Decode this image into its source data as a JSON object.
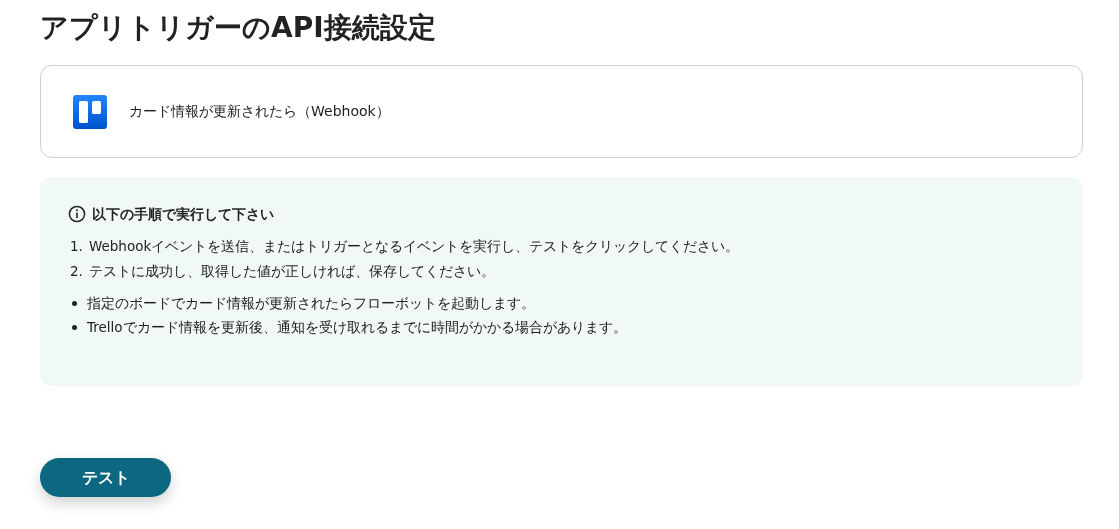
{
  "title": "アプリトリガーのAPI接続設定",
  "trigger": {
    "label": "カード情報が更新されたら（Webhook）"
  },
  "info": {
    "heading": "以下の手順で実行して下さい",
    "steps": [
      {
        "number": "1.",
        "text": "Webhookイベントを送信、またはトリガーとなるイベントを実行し、テストをクリックしてください。"
      },
      {
        "number": "2.",
        "text": "テストに成功し、取得した値が正しければ、保存してください。"
      }
    ],
    "notes": [
      "指定のボードでカード情報が更新されたらフローボットを起動します。",
      "Trelloでカード情報を更新後、通知を受け取れるまでに時間がかかる場合があります。"
    ]
  },
  "button": {
    "label": "テスト"
  }
}
